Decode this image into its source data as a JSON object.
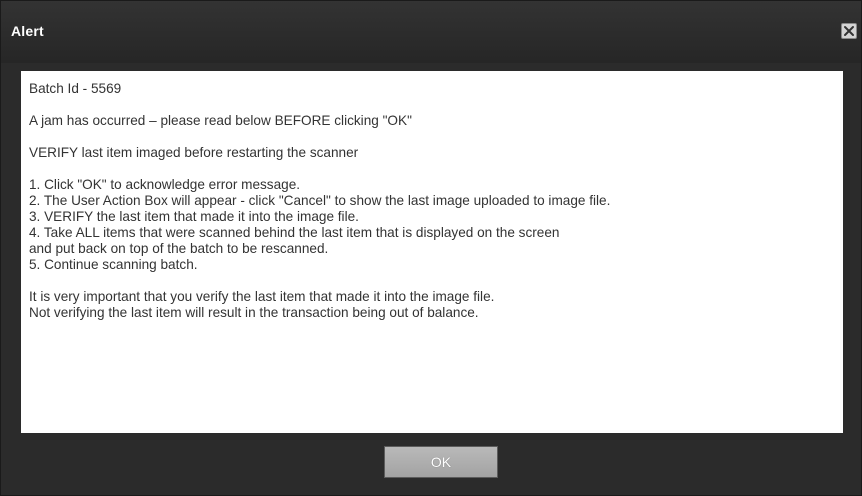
{
  "dialog": {
    "title": "Alert",
    "close_icon": "close-icon"
  },
  "message": {
    "batch_id": "Batch Id - 5569",
    "jam_notice": "A jam has occurred – please read below BEFORE clicking \"OK\"",
    "verify_notice": "VERIFY last item imaged before restarting the scanner",
    "steps": [
      "1. Click \"OK\" to acknowledge error message.",
      "2. The User Action Box will appear - click \"Cancel\" to show the last image uploaded to image file.",
      "3. VERIFY the last item that made it into the image file.",
      "4. Take ALL items that were scanned behind the last item that is displayed on the screen",
      "and put back on top of the batch to be rescanned.",
      "5. Continue scanning batch."
    ],
    "importance": [
      "It is very important that you verify the last item that made it into the image file.",
      "Not verifying the last item will result in the transaction being out of balance."
    ]
  },
  "footer": {
    "ok_label": "OK"
  }
}
